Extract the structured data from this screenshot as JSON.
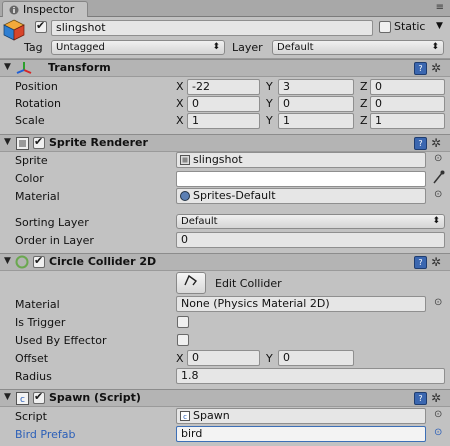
{
  "tab": {
    "title": "Inspector",
    "menu_icon": "menu-lines-icon"
  },
  "gameobject": {
    "name": "slingshot",
    "static_label": "Static",
    "tag_label": "Tag",
    "tag_value": "Untagged",
    "layer_label": "Layer",
    "layer_value": "Default"
  },
  "transform": {
    "title": "Transform",
    "position_label": "Position",
    "rotation_label": "Rotation",
    "scale_label": "Scale",
    "position": {
      "x": "-22",
      "y": "3",
      "z": "0"
    },
    "rotation": {
      "x": "0",
      "y": "0",
      "z": "0"
    },
    "scale": {
      "x": "1",
      "y": "1",
      "z": "1"
    }
  },
  "axes": {
    "x": "X",
    "y": "Y",
    "z": "Z"
  },
  "sprite_renderer": {
    "title": "Sprite Renderer",
    "sprite_label": "Sprite",
    "sprite_value": "slingshot",
    "color_label": "Color",
    "material_label": "Material",
    "material_value": "Sprites-Default",
    "sorting_layer_label": "Sorting Layer",
    "sorting_layer_value": "Default",
    "order_label": "Order in Layer",
    "order_value": "0"
  },
  "circle_collider": {
    "title": "Circle Collider 2D",
    "edit_collider_label": "Edit Collider",
    "material_label": "Material",
    "material_value": "None (Physics Material 2D)",
    "is_trigger_label": "Is Trigger",
    "used_by_effector_label": "Used By Effector",
    "offset_label": "Offset",
    "offset": {
      "x": "0",
      "y": "0"
    },
    "radius_label": "Radius",
    "radius_value": "1.8"
  },
  "spawn": {
    "title": "Spawn (Script)",
    "script_label": "Script",
    "script_value": "Spawn",
    "bird_prefab_label": "Bird Prefab",
    "bird_prefab_value": "bird"
  },
  "colors": {
    "highlight_label": "#2b5fb8",
    "help_icon": "#3b67b0"
  }
}
